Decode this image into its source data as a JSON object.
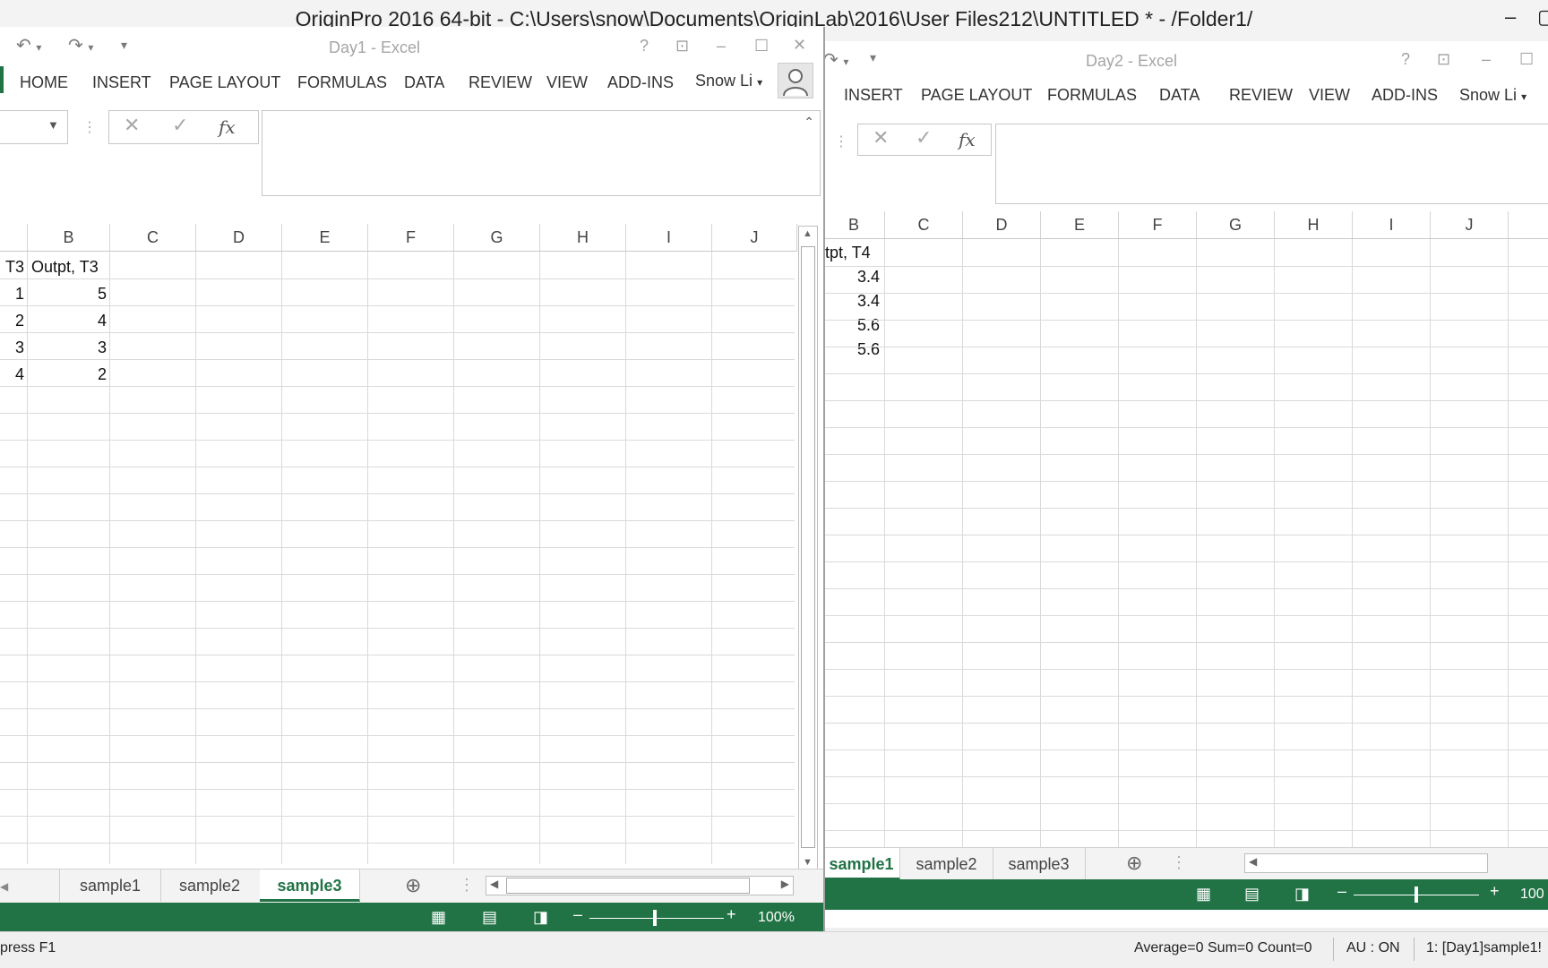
{
  "origin": {
    "title": "OriginPro 2016 64-bit - C:\\Users\\snow\\Documents\\OriginLab\\2016\\User Files212\\UNTITLED * - /Folder1/",
    "status_left": "press F1",
    "status_stats": "Average=0 Sum=0 Count=0",
    "status_au": "AU : ON",
    "status_book": "1: [Day1]sample1!"
  },
  "excel1": {
    "title": "Day1 - Excel",
    "user": "Snow Li",
    "tabs": [
      "HOME",
      "INSERT",
      "PAGE LAYOUT",
      "FORMULAS",
      "DATA",
      "REVIEW",
      "VIEW",
      "ADD-INS"
    ],
    "columns": [
      "B",
      "C",
      "D",
      "E",
      "F",
      "G",
      "H",
      "I",
      "J"
    ],
    "header_a": "T3",
    "header_b": "Outpt, T3",
    "rows": [
      {
        "a": "1",
        "b": "5"
      },
      {
        "a": "2",
        "b": "4"
      },
      {
        "a": "3",
        "b": "3"
      },
      {
        "a": "4",
        "b": "2"
      }
    ],
    "sheets": [
      "sample1",
      "sample2",
      "sample3"
    ],
    "active_sheet": "sample3",
    "zoom": "100%"
  },
  "excel2": {
    "title": "Day2 - Excel",
    "user": "Snow Li",
    "tabs": [
      "INSERT",
      "PAGE LAYOUT",
      "FORMULAS",
      "DATA",
      "REVIEW",
      "VIEW",
      "ADD-INS"
    ],
    "columns": [
      "B",
      "C",
      "D",
      "E",
      "F",
      "G",
      "H",
      "I",
      "J"
    ],
    "header_b": "tpt, T4",
    "rows": [
      "3.4",
      "3.4",
      "5.6",
      "5.6"
    ],
    "sheets": [
      "sample1",
      "sample2",
      "sample3"
    ],
    "active_sheet": "sample1",
    "zoom": "100"
  },
  "colors": {
    "excel_green": "#217346"
  }
}
